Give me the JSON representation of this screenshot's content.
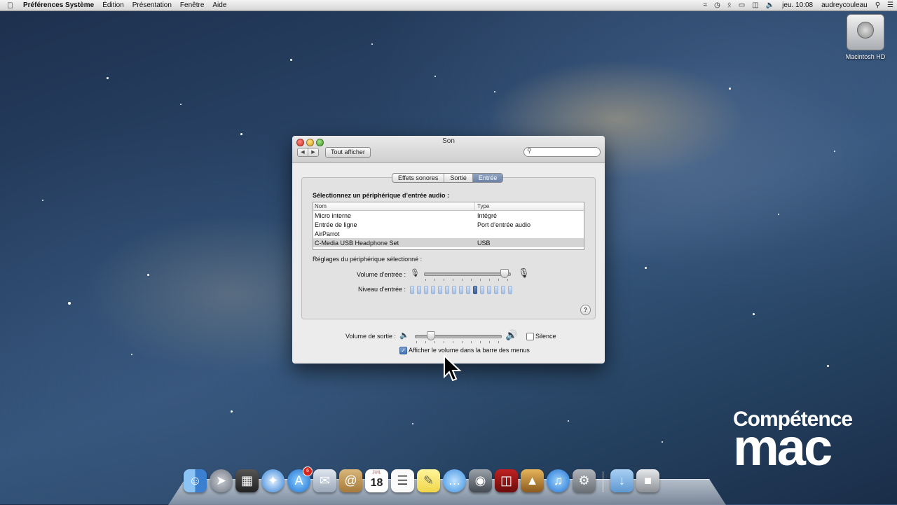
{
  "menubar": {
    "apple": "",
    "app_name": "Préférences Système",
    "menus": [
      "Édition",
      "Présentation",
      "Fenêtre",
      "Aide"
    ],
    "clock": "jeu. 10:08",
    "user": "audreycouleau"
  },
  "desktop": {
    "hd_label": "Macintosh HD"
  },
  "window": {
    "title": "Son",
    "show_all": "Tout afficher",
    "search_placeholder": "",
    "tabs": [
      {
        "label": "Effets sonores",
        "active": false
      },
      {
        "label": "Sortie",
        "active": false
      },
      {
        "label": "Entrée",
        "active": true
      }
    ],
    "select_heading": "Sélectionnez un périphérique d’entrée audio :",
    "table": {
      "col_name": "Nom",
      "col_type": "Type",
      "rows": [
        {
          "name": "Micro interne",
          "type": "Intégré",
          "selected": false
        },
        {
          "name": "Entrée de ligne",
          "type": "Port d’entrée audio",
          "selected": false
        },
        {
          "name": "AirParrot",
          "type": "",
          "selected": false
        },
        {
          "name": "C-Media USB Headphone Set",
          "type": "USB",
          "selected": true
        }
      ]
    },
    "settings_heading": "Réglages du périphérique sélectionné :",
    "input_volume_label": "Volume d’entrée :",
    "input_volume_value": 0.97,
    "input_level_label": "Niveau d’entrée :",
    "input_level_segments": 15,
    "input_level_active_index": 9,
    "help": "?",
    "output_volume_label": "Volume de sortie :",
    "output_volume_value": 0.15,
    "mute_label": "Silence",
    "mute_checked": false,
    "show_in_menubar_label": "Afficher le volume dans la barre des menus",
    "show_in_menubar_checked": true
  },
  "logo": {
    "line1": "Compétence",
    "line2": "mac"
  },
  "dock": {
    "calendar_month": "JUIL",
    "calendar_day": "18",
    "app_store_badge": "6"
  },
  "colors": {
    "selection_tab": "#6b83a8",
    "traffic_red": "#d42c22",
    "traffic_yellow": "#d9a21a",
    "traffic_green": "#3f9a26"
  }
}
